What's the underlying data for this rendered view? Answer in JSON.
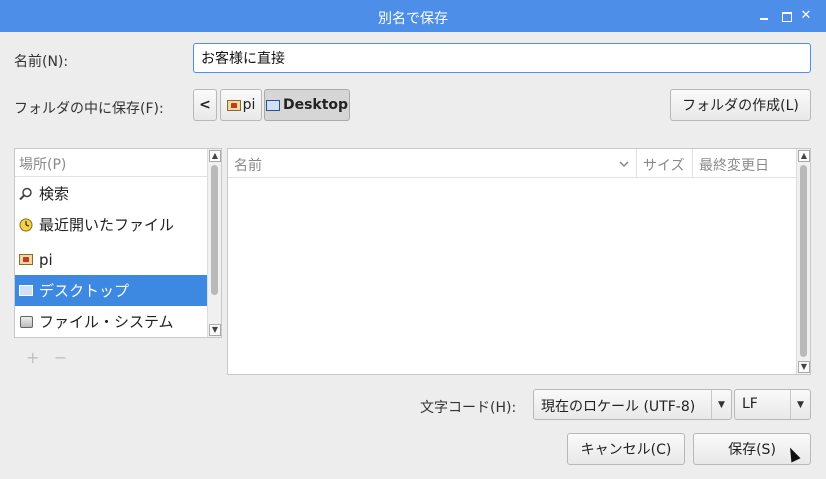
{
  "window": {
    "title": "別名で保存"
  },
  "name": {
    "label": "名前(N):",
    "value": "お客様に直接"
  },
  "path": {
    "label": "フォルダの中に保存(F):",
    "back_symbol": "<",
    "crumbs": [
      "pi",
      "Desktop"
    ],
    "new_folder_label": "フォルダの作成(L)"
  },
  "places": {
    "header": "場所(P)",
    "items": [
      {
        "label": "検索",
        "icon": "search-icon"
      },
      {
        "label": "最近開いたファイル",
        "icon": "recent-icon"
      },
      {
        "label": "pi",
        "icon": "home-folder-icon"
      },
      {
        "label": "デスクトップ",
        "icon": "desktop-icon"
      },
      {
        "label": "ファイル・システム",
        "icon": "drive-icon"
      }
    ],
    "add_symbol": "+",
    "remove_symbol": "−"
  },
  "files": {
    "columns": [
      "名前",
      "サイズ",
      "最終変更日"
    ]
  },
  "encoding": {
    "label": "文字コード(H):",
    "value": "現在のロケール (UTF-8)",
    "line_ending": "LF"
  },
  "buttons": {
    "cancel": "キャンセル(C)",
    "save": "保存(S)"
  }
}
